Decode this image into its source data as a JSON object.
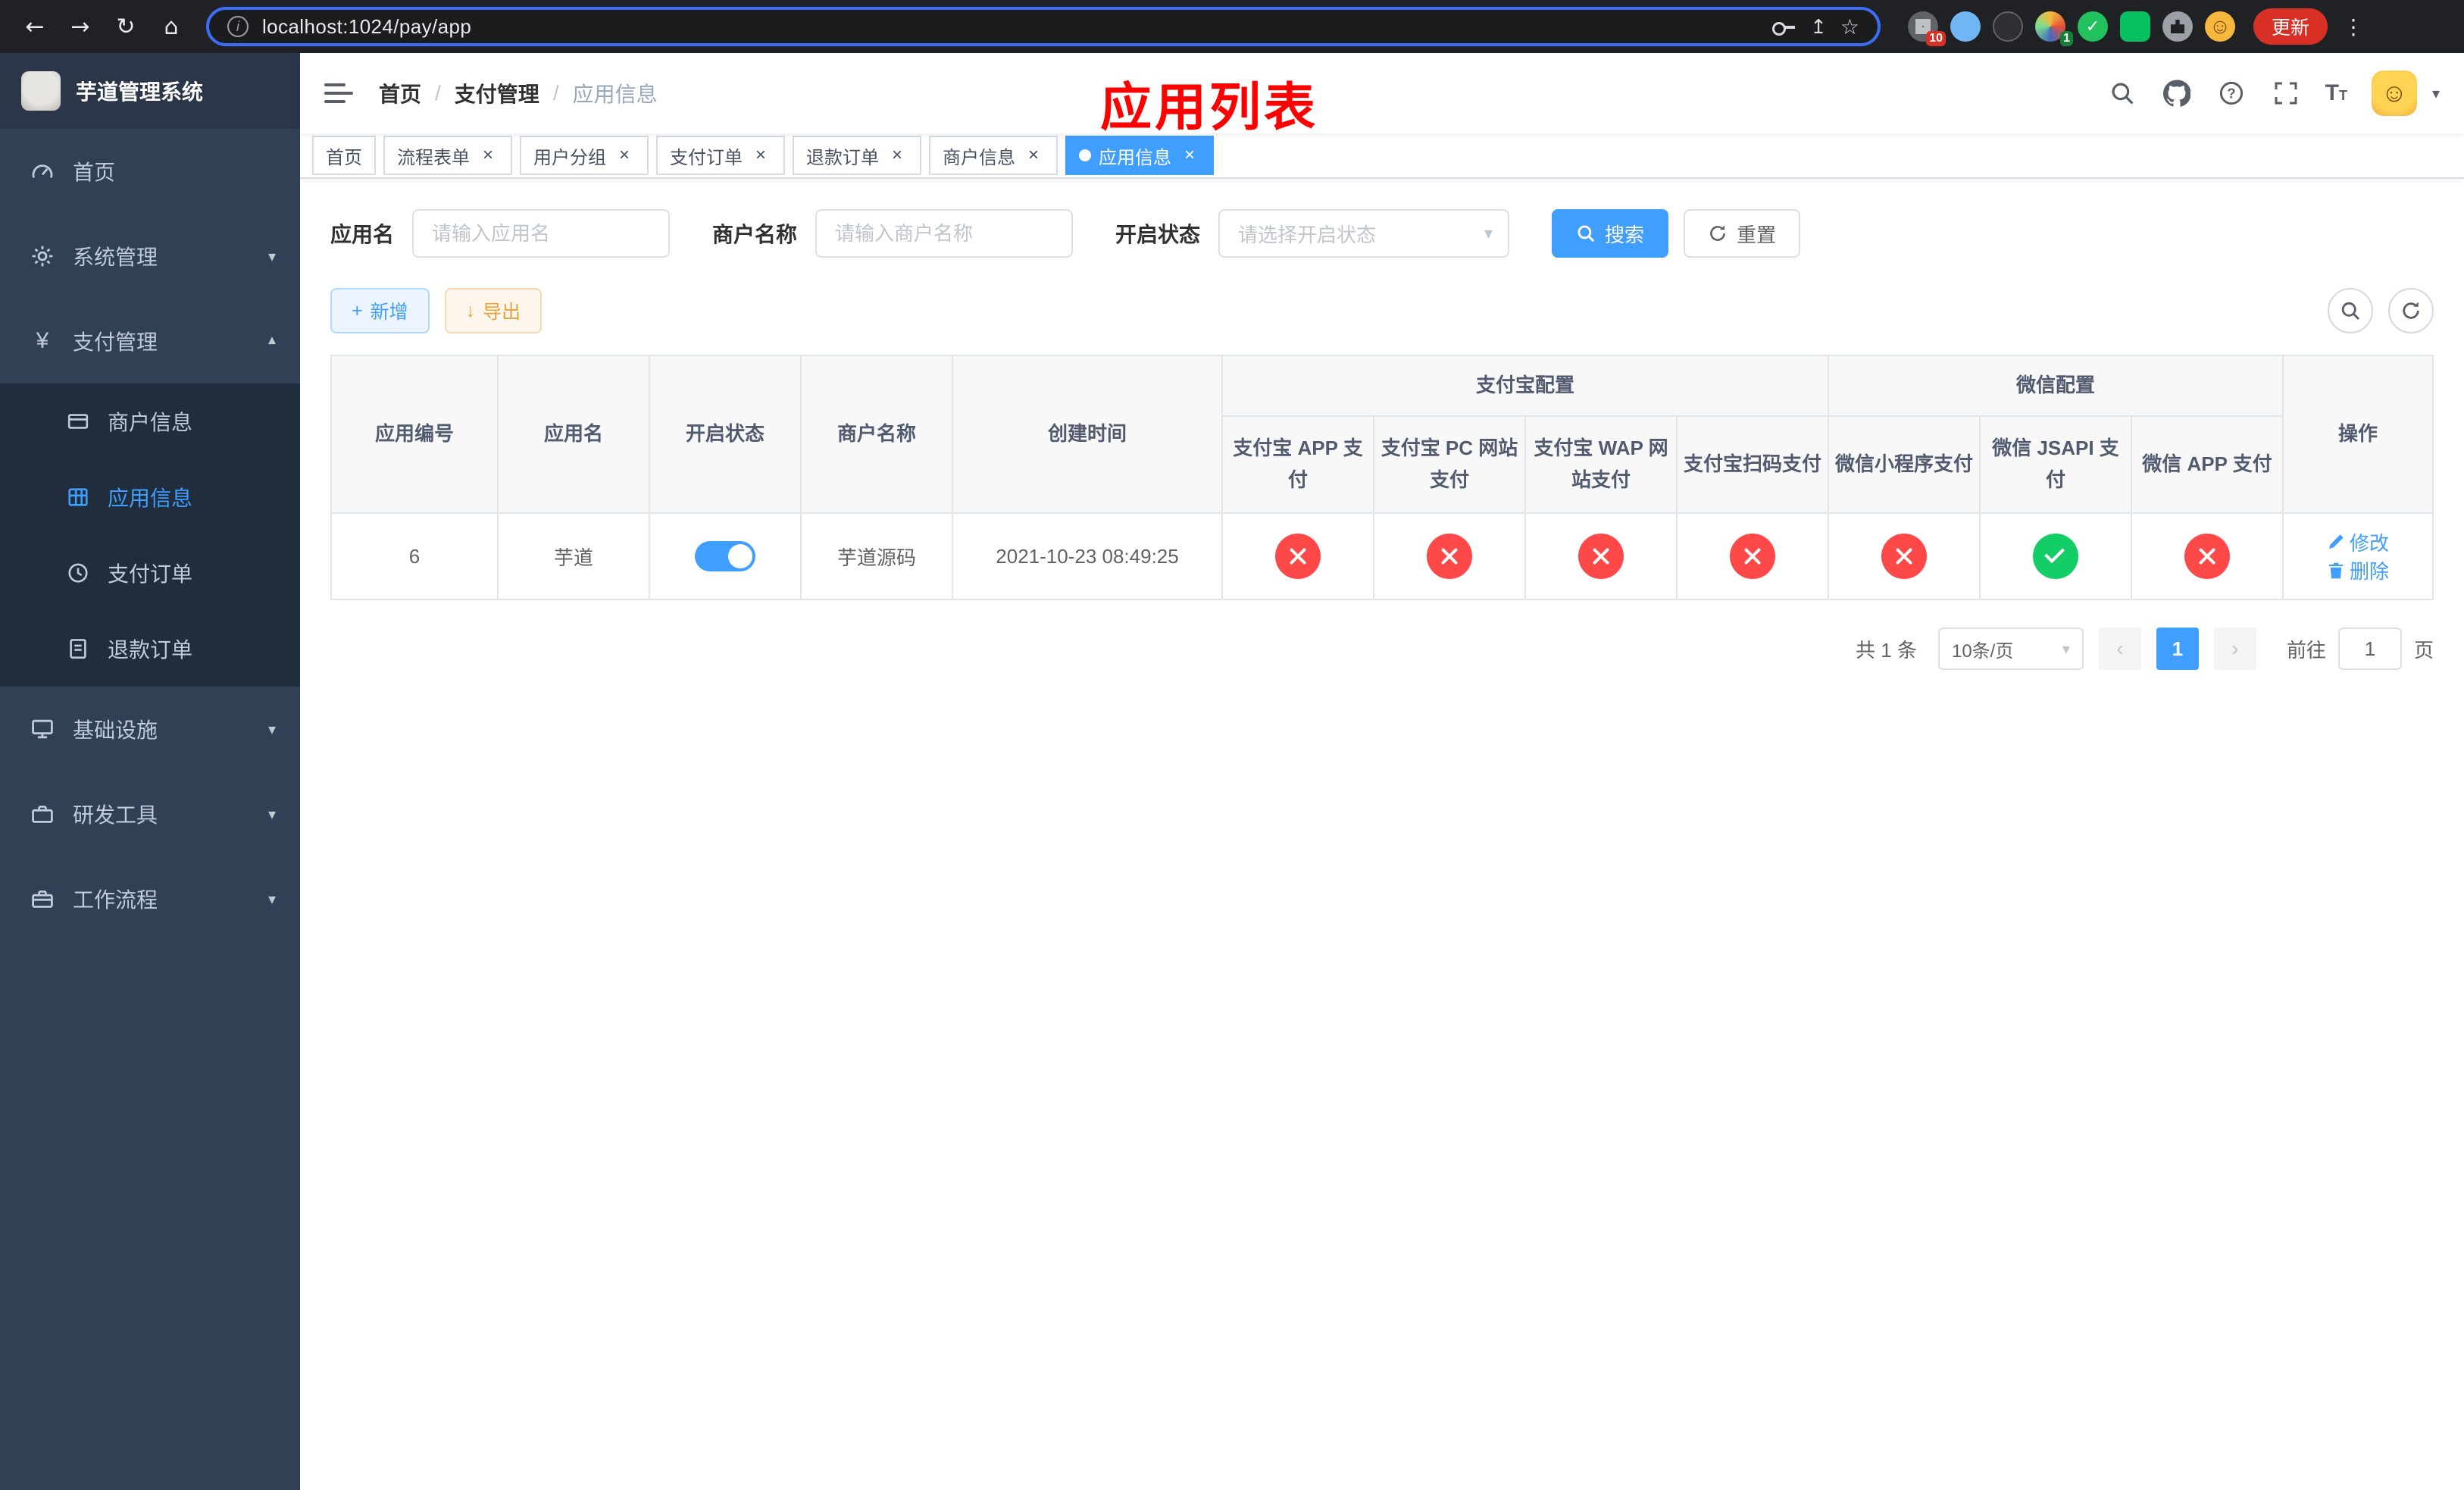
{
  "browser": {
    "url": "localhost:1024/pay/app",
    "update_button": "更新",
    "extension_badge_grid": "10",
    "extension_badge_colorful": "1"
  },
  "icons": {
    "back": "←",
    "forward": "→",
    "reload": "↻",
    "home": "⌂",
    "info": "i",
    "share": "↥",
    "star": "☆",
    "menu_dots": "⋮",
    "face": "☺",
    "check": "✓",
    "close": "×",
    "caret_down": "▾",
    "plus": "+",
    "download": "↓",
    "slash": "/",
    "prev": "‹",
    "next": "›",
    "yen": "¥"
  },
  "sidebar": {
    "app_title": "芋道管理系统",
    "items": {
      "home": "首页",
      "system": "系统管理",
      "payment": "支付管理",
      "infra": "基础设施",
      "devtools": "研发工具",
      "workflow": "工作流程"
    },
    "payment_children": {
      "merchant": "商户信息",
      "app": "应用信息",
      "order": "支付订单",
      "refund": "退款订单"
    }
  },
  "header": {
    "breadcrumb": {
      "home": "首页",
      "section": "支付管理",
      "current": "应用信息"
    },
    "overlay_title": "应用列表"
  },
  "tabs": [
    {
      "label": "首页"
    },
    {
      "label": "流程表单"
    },
    {
      "label": "用户分组"
    },
    {
      "label": "支付订单"
    },
    {
      "label": "退款订单"
    },
    {
      "label": "商户信息"
    },
    {
      "label": "应用信息"
    }
  ],
  "filters": {
    "app_name_label": "应用名",
    "app_name_placeholder": "请输入应用名",
    "merchant_label": "商户名称",
    "merchant_placeholder": "请输入商户名称",
    "status_label": "开启状态",
    "status_placeholder": "请选择开启状态",
    "search_button": "搜索",
    "reset_button": "重置"
  },
  "toolbar": {
    "add_button": "新增",
    "export_button": "导出"
  },
  "table": {
    "headers": {
      "app_id": "应用编号",
      "app_name": "应用名",
      "status": "开启状态",
      "merchant": "商户名称",
      "created": "创建时间",
      "alipay_group": "支付宝配置",
      "wechat_group": "微信配置",
      "alipay_app": "支付宝 APP 支付",
      "alipay_pc": "支付宝 PC 网站支付",
      "alipay_wap": "支付宝 WAP 网站支付",
      "alipay_qr": "支付宝扫码支付",
      "wx_lite": "微信小程序支付",
      "wx_jsapi": "微信 JSAPI 支付",
      "wx_app": "微信 APP 支付",
      "actions": "操作"
    },
    "rows": [
      {
        "app_id": "6",
        "app_name": "芋道",
        "enabled": true,
        "merchant": "芋道源码",
        "created": "2021-10-23 08:49:25",
        "channels": [
          "fail",
          "fail",
          "fail",
          "fail",
          "fail",
          "success",
          "fail"
        ],
        "edit": "修改",
        "delete": "删除"
      }
    ]
  },
  "pagination": {
    "total": "共 1 条",
    "page_size": "10条/页",
    "page": "1",
    "goto_label": "前往",
    "goto_value": "1",
    "goto_unit": "页"
  }
}
